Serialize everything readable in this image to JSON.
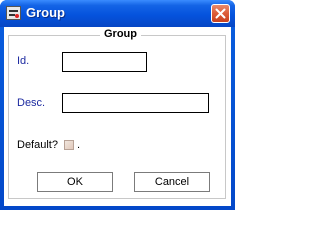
{
  "window": {
    "title": "Group",
    "close_symbol": "×"
  },
  "groupbox": {
    "legend": "Group"
  },
  "form": {
    "id_label": "Id.",
    "id_value": "",
    "desc_label": "Desc.",
    "desc_value": "",
    "default_label": "Default?",
    "default_checked": false,
    "default_suffix": "."
  },
  "buttons": {
    "ok_label": "OK",
    "cancel_label": "Cancel"
  },
  "colors": {
    "titlebar": "#0553dd",
    "label_blue": "#1c2aa0",
    "close_button": "#dc5c38"
  },
  "icons": {
    "app": "app-window-icon",
    "close": "close-icon"
  }
}
